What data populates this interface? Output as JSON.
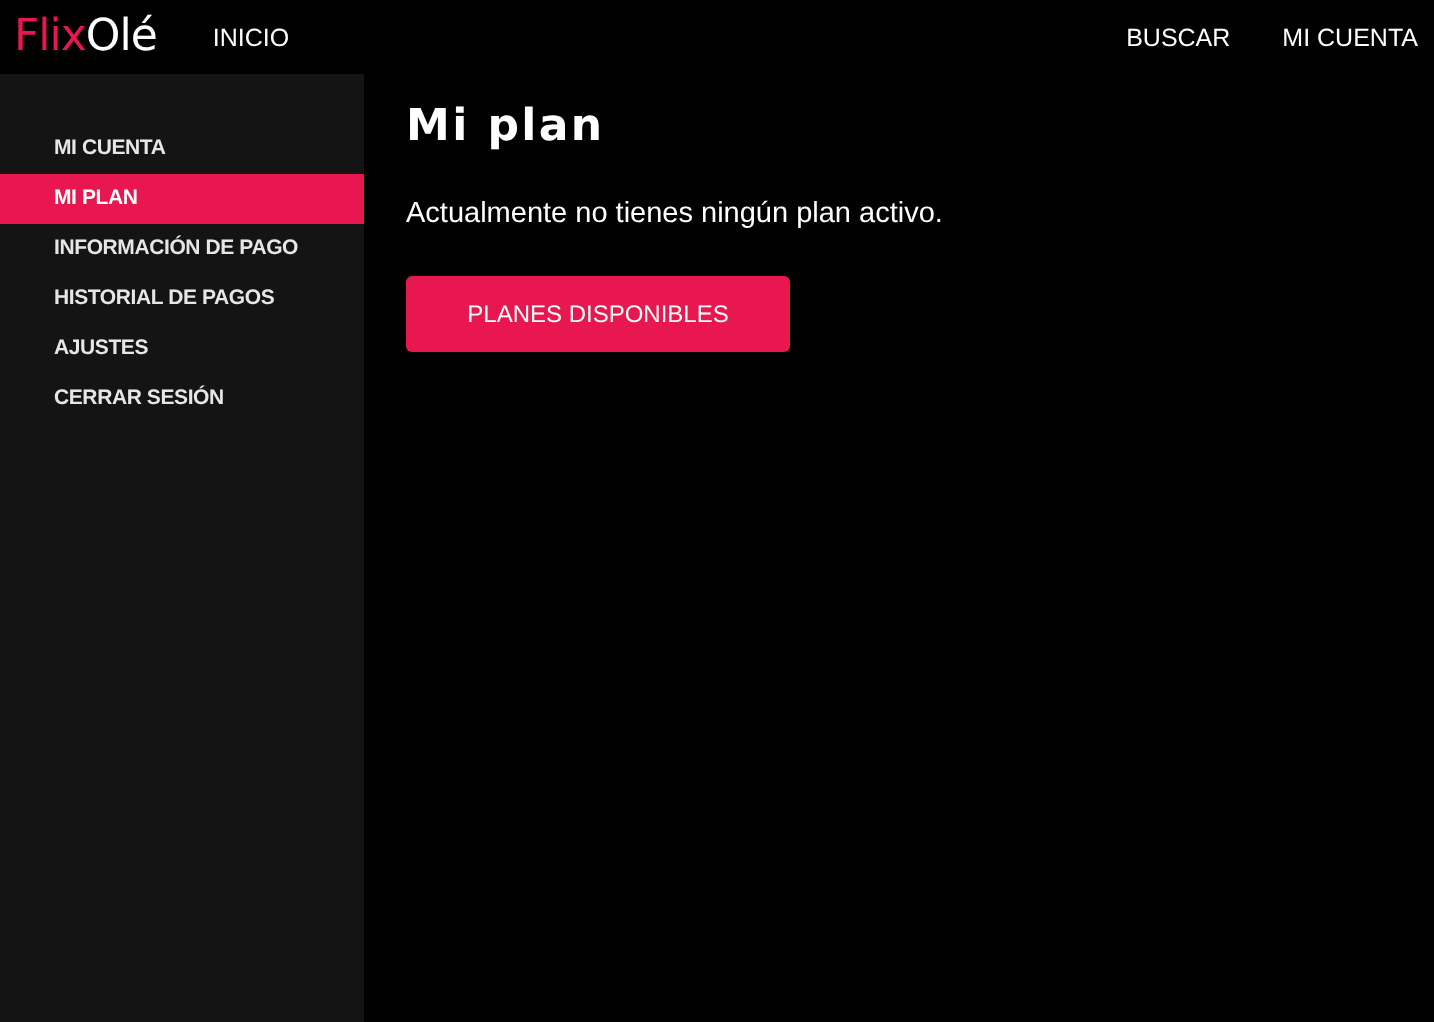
{
  "header": {
    "logo": {
      "first": "Flix",
      "second": "Olé"
    },
    "nav_left": [
      "INICIO"
    ],
    "nav_right": [
      "BUSCAR",
      "MI CUENTA"
    ]
  },
  "sidebar": {
    "items": [
      {
        "label": "MI CUENTA",
        "selected": false
      },
      {
        "label": "MI PLAN",
        "selected": true
      },
      {
        "label": "INFORMACIÓN DE PAGO",
        "selected": false
      },
      {
        "label": "HISTORIAL DE PAGOS",
        "selected": false
      },
      {
        "label": "AJUSTES",
        "selected": false
      },
      {
        "label": "CERRAR SESIÓN",
        "selected": false
      }
    ]
  },
  "main": {
    "title": "Mi plan",
    "message": "Actualmente no tienes ningún plan activo.",
    "button": "PLANES DISPONIBLES"
  }
}
